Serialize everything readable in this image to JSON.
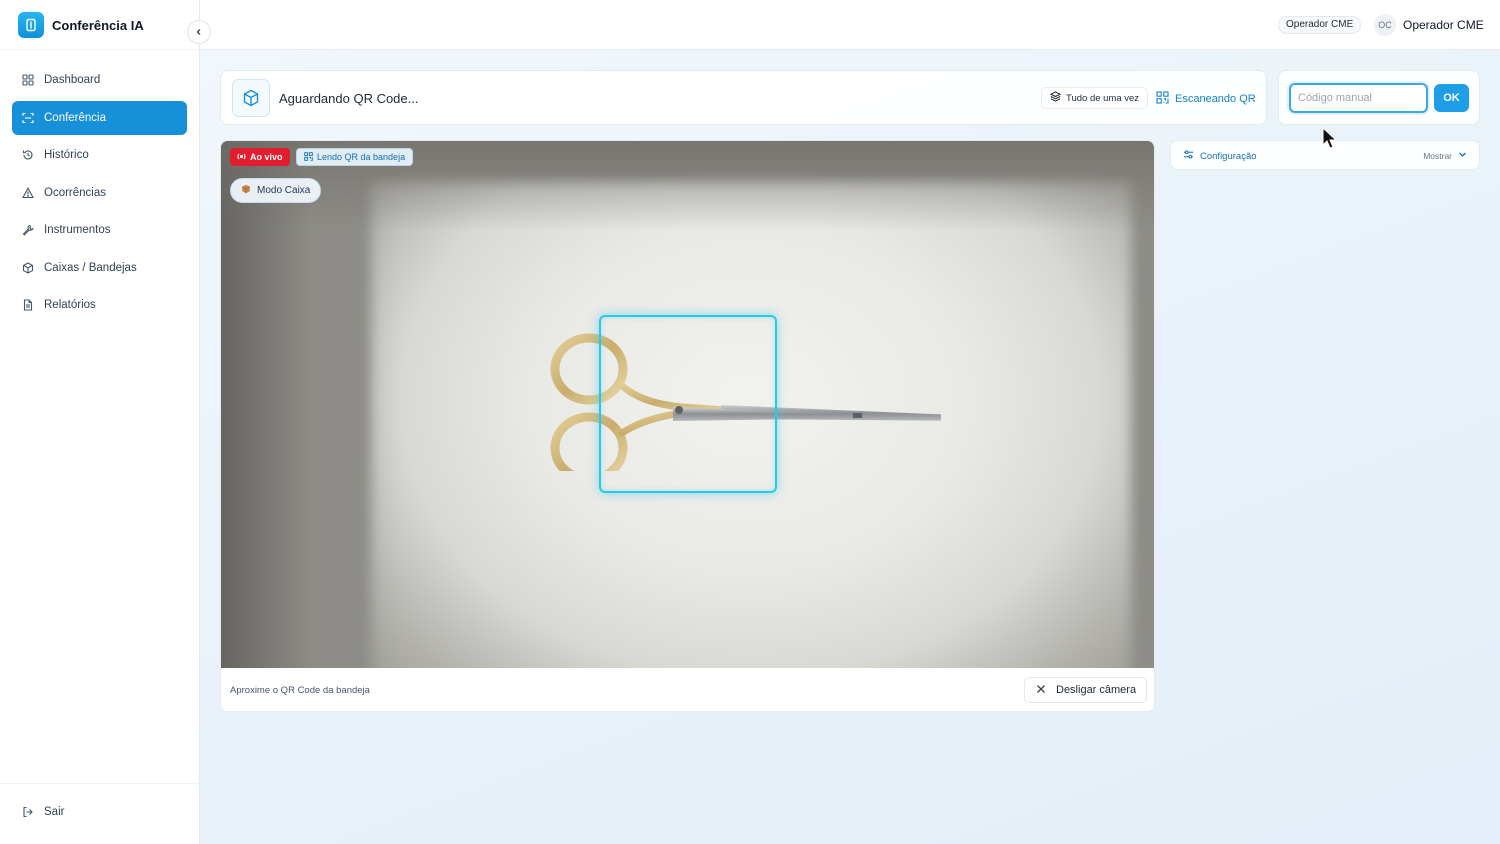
{
  "app": {
    "title": "Conferência IA",
    "brand_color": "#1590d9"
  },
  "sidebar": {
    "items": [
      {
        "label": "Dashboard",
        "icon": "grid-icon",
        "active": false
      },
      {
        "label": "Conferência",
        "icon": "scan-icon",
        "active": true
      },
      {
        "label": "Histórico",
        "icon": "history-icon",
        "active": false
      },
      {
        "label": "Ocorrências",
        "icon": "alert-triangle-icon",
        "active": false
      },
      {
        "label": "Instrumentos",
        "icon": "wrench-icon",
        "active": false
      },
      {
        "label": "Caixas / Bandejas",
        "icon": "box-icon",
        "active": false
      },
      {
        "label": "Relatórios",
        "icon": "file-text-icon",
        "active": false
      }
    ],
    "logout_label": "Sair"
  },
  "header": {
    "role_badge": "Operador CME",
    "avatar_initials": "OC",
    "user_name": "Operador CME"
  },
  "status": {
    "text": "Aguardando QR Code...",
    "mode_all_label": "Tudo de uma vez",
    "mode_qr_label": "Escaneando QR"
  },
  "manual_code": {
    "placeholder": "Código manual",
    "value": "",
    "ok_label": "OK"
  },
  "camera": {
    "live_badge": "Ao vivo",
    "reading_badge": "Lendo QR da bandeja",
    "mode_badge": "Modo Caixa",
    "hint": "Aproxime o QR Code da bandeja",
    "turn_off_label": "Desligar câmera",
    "scan_frame_color": "#29c8ea",
    "live_color": "#e11d2e"
  },
  "config": {
    "title": "Configuração",
    "toggle_label": "Mostrar"
  }
}
